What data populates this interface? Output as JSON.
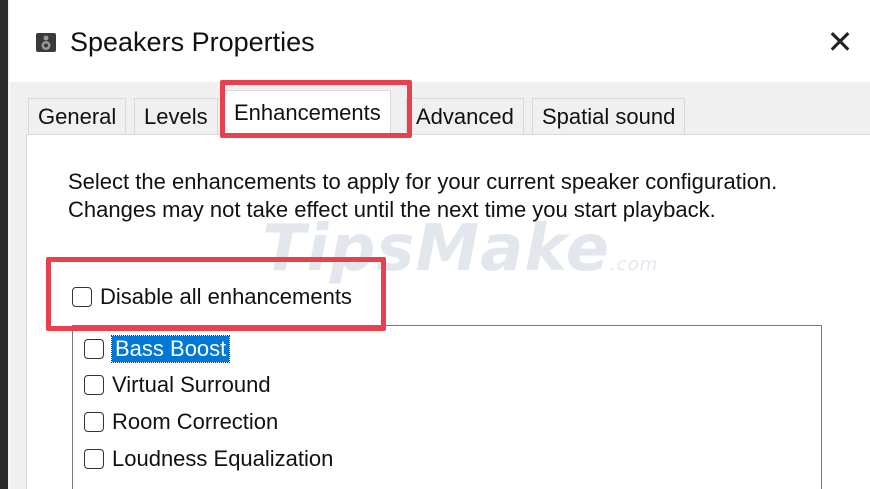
{
  "window": {
    "title": "Speakers Properties",
    "close_label": "✕"
  },
  "tabs": [
    {
      "label": "General",
      "active": false
    },
    {
      "label": "Levels",
      "active": false
    },
    {
      "label": "Enhancements",
      "active": true
    },
    {
      "label": "Advanced",
      "active": false
    },
    {
      "label": "Spatial sound",
      "active": false
    }
  ],
  "enhancements": {
    "description": "Select the enhancements to apply for your current speaker configuration. Changes may not take effect until the next time you start playback.",
    "disable_all_label": "Disable all enhancements",
    "disable_all_checked": false,
    "items": [
      {
        "label": "Bass Boost",
        "checked": false,
        "selected": true
      },
      {
        "label": "Virtual Surround",
        "checked": false,
        "selected": false
      },
      {
        "label": "Room Correction",
        "checked": false,
        "selected": false
      },
      {
        "label": "Loudness Equalization",
        "checked": false,
        "selected": false
      }
    ]
  },
  "watermark": {
    "text": "TipsMake",
    "suffix": ".com"
  },
  "colors": {
    "highlight": "#e8414d",
    "selection": "#0078d7",
    "dialog_bg": "#f0f0f0"
  },
  "icons": {
    "title": "speaker-icon",
    "close": "close-icon"
  }
}
